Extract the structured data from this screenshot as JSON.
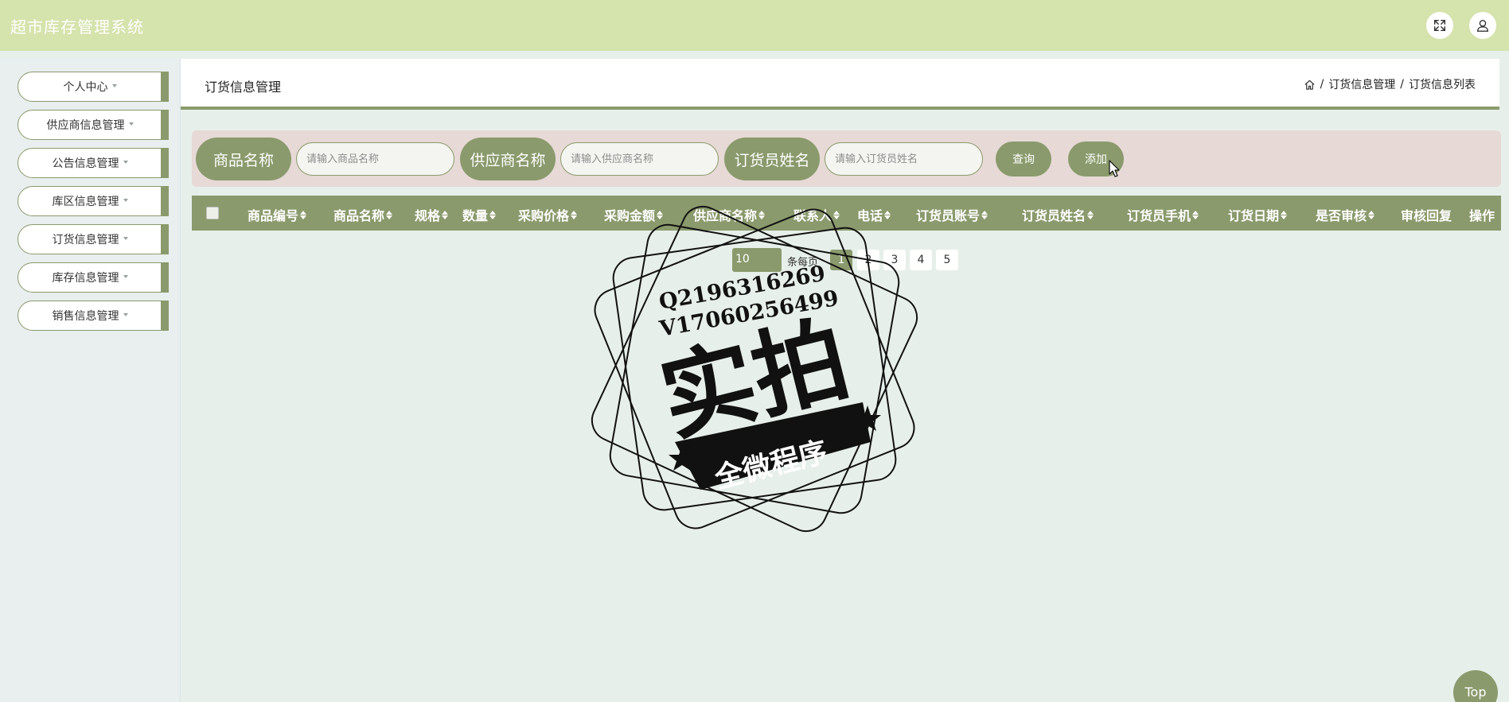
{
  "app": {
    "title": "超市库存管理系统"
  },
  "sidebar": {
    "items": [
      {
        "label": "个人中心"
      },
      {
        "label": "供应商信息管理"
      },
      {
        "label": "公告信息管理"
      },
      {
        "label": "库区信息管理"
      },
      {
        "label": "订货信息管理"
      },
      {
        "label": "库存信息管理"
      },
      {
        "label": "销售信息管理"
      }
    ]
  },
  "page": {
    "title": "订货信息管理",
    "breadcrumb": [
      "订货信息管理",
      "订货信息列表"
    ],
    "breadcrumb_sep": "/"
  },
  "search": {
    "fields": [
      {
        "label": "商品名称",
        "placeholder": "请输入商品名称",
        "value": ""
      },
      {
        "label": "供应商名称",
        "placeholder": "请输入供应商名称",
        "value": ""
      },
      {
        "label": "订货员姓名",
        "placeholder": "请输入订货员姓名",
        "value": ""
      }
    ],
    "query_label": "查询",
    "add_label": "添加"
  },
  "table": {
    "columns": [
      "商品编号",
      "商品名称",
      "规格",
      "数量",
      "采购价格",
      "采购金额",
      "供应商名称",
      "联系人",
      "电话",
      "订货员账号",
      "订货员姓名",
      "订货员手机",
      "订货日期",
      "是否审核",
      "审核回复",
      "操作"
    ],
    "rows": []
  },
  "pagination": {
    "page_size": "10",
    "per_page_label": "条每页",
    "pages": [
      "1",
      "2",
      "3",
      "4",
      "5"
    ],
    "current_page": "1"
  },
  "watermark": {
    "line1": "Q2196316269",
    "line2": "V17060256499",
    "main": "实拍",
    "banner": "全微程序"
  },
  "back_to_top": "Top",
  "colors": {
    "header_bg": "#d5e3ac",
    "accent": "#8a9a6c",
    "page_bg": "#e7efea",
    "search_bg": "#e6d9d6"
  }
}
